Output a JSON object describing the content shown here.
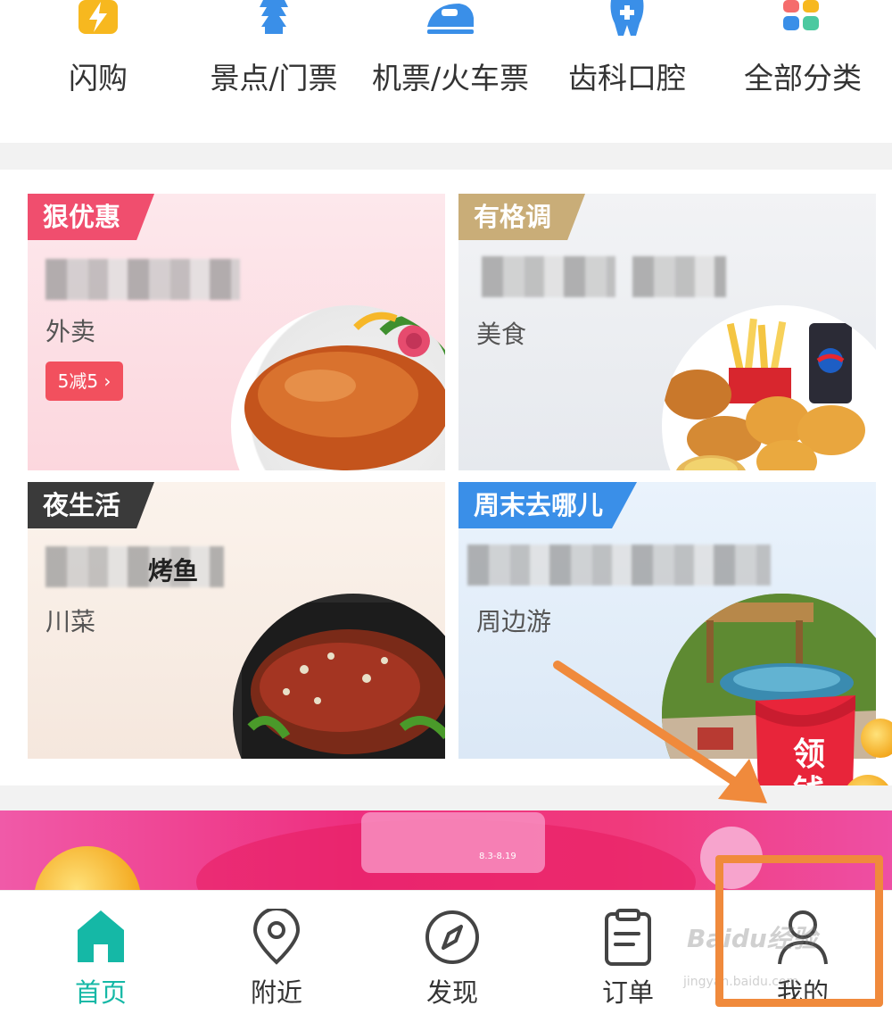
{
  "categories": [
    {
      "label": "闪购",
      "icon": "lightning-icon"
    },
    {
      "label": "景点/门票",
      "icon": "pagoda-icon"
    },
    {
      "label": "机票/火车票",
      "icon": "train-icon"
    },
    {
      "label": "齿科口腔",
      "icon": "tooth-icon"
    },
    {
      "label": "全部分类",
      "icon": "grid-icon"
    }
  ],
  "cards": [
    {
      "tag": "狠优惠",
      "subtitle": "外卖",
      "coupon": "5减5 ›",
      "tag_color": "#f04e6e",
      "photo": "roast-duck"
    },
    {
      "tag": "有格调",
      "subtitle": "美食",
      "tag_color": "#c9ad78",
      "photo": "fried-chicken"
    },
    {
      "tag": "夜生活",
      "subtitle": "川菜",
      "title_fragment": "烤鱼",
      "tag_color": "#3a3a3a",
      "photo": "grilled-fish"
    },
    {
      "tag": "周末去哪儿",
      "subtitle": "周边游",
      "tag_color": "#3a8fe8",
      "photo": "garden-pool"
    }
  ],
  "envelope": {
    "text": "领钱"
  },
  "banner": {
    "date": "8.3-8.19"
  },
  "nav": [
    {
      "label": "首页",
      "icon": "home-icon",
      "active": true
    },
    {
      "label": "附近",
      "icon": "location-pin-icon",
      "active": false
    },
    {
      "label": "发现",
      "icon": "compass-icon",
      "active": false
    },
    {
      "label": "订单",
      "icon": "clipboard-icon",
      "active": false
    },
    {
      "label": "我的",
      "icon": "person-icon",
      "active": false
    }
  ],
  "watermark": {
    "text": "Baidu经验",
    "url": "jingyan.baidu.com"
  },
  "colors": {
    "accent": "#15b8a6",
    "annotation": "#f08a3c"
  }
}
